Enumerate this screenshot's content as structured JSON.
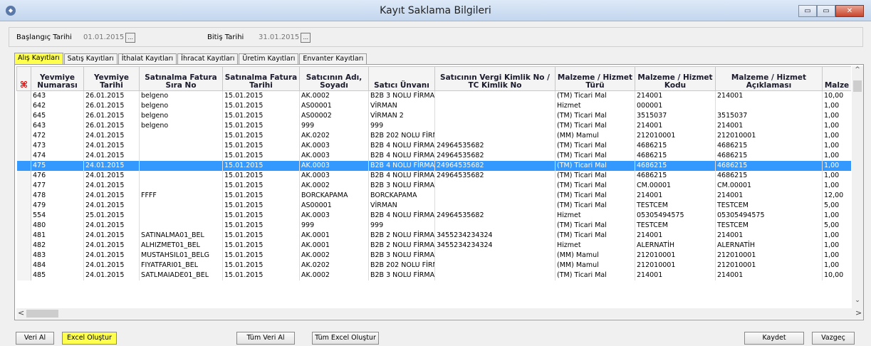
{
  "window": {
    "title": "Kayıt Saklama Bilgileri",
    "min": "▭",
    "max": "▭",
    "close": "✕"
  },
  "dates": {
    "start_label": "Başlangıç Tarihi",
    "start_value": "01.01.2015",
    "end_label": "Bitiş Tarihi",
    "end_value": "31.01.2015",
    "picker": "..."
  },
  "tabs": [
    "Alış Kayıtları",
    "Satış Kayıtları",
    "İthalat Kayıtları",
    "İhracat Kayıtları",
    "Üretim Kayıtları",
    "Envanter Kayıtları"
  ],
  "grid": {
    "corner_icon": "⌘",
    "columns": [
      "Yevmiye Numarası",
      "Yevmiye Tarihi",
      "Satınalma Fatura Sıra No",
      "Satınalma Fatura Tarihi",
      "Satıcının Adı, Soyadı",
      "Satıcı Ünvanı",
      "Satıcının Vergi Kimlik No / TC Kimlik No",
      "Malzeme / Hizmet Türü",
      "Malzeme / Hizmet Kodu",
      "Malzeme / Hizmet Açıklaması",
      "Malze"
    ],
    "rows": [
      [
        "643",
        "26.01.2015",
        "belgeno",
        "15.01.2015",
        "AK.0002",
        "B2B 3 NOLU FİRMA",
        "",
        "(TM) Ticari Mal",
        "214001",
        "214001",
        "10,00"
      ],
      [
        "642",
        "26.01.2015",
        "belgeno",
        "15.01.2015",
        "AS00001",
        "VİRMAN",
        "",
        "Hizmet",
        "000001",
        "",
        "1,00"
      ],
      [
        "645",
        "26.01.2015",
        "belgeno",
        "15.01.2015",
        "AS00002",
        "VİRMAN 2",
        "",
        "(TM) Ticari Mal",
        "3515037",
        "3515037",
        "1,00"
      ],
      [
        "643",
        "26.01.2015",
        "belgeno",
        "15.01.2015",
        "999",
        "999",
        "",
        "(TM) Ticari Mal",
        "214001",
        "214001",
        "1,00"
      ],
      [
        "472",
        "24.01.2015",
        "",
        "15.01.2015",
        "AK.0202",
        "B2B 202 NOLU FİRM.",
        "",
        "(MM) Mamul",
        "212010001",
        "212010001",
        "1,00"
      ],
      [
        "473",
        "24.01.2015",
        "",
        "15.01.2015",
        "AK.0003",
        "B2B 4 NOLU FİRMA",
        "24964535682",
        "(TM) Ticari Mal",
        "4686215",
        "4686215",
        "1,00"
      ],
      [
        "474",
        "24.01.2015",
        "",
        "15.01.2015",
        "AK.0003",
        "B2B 4 NOLU FİRMA",
        "24964535682",
        "(TM) Ticari Mal",
        "4686215",
        "4686215",
        "1,00"
      ],
      [
        "475",
        "24.01.2015",
        "",
        "15.01.2015",
        "AK.0003",
        "B2B 4 NOLU FİRMA",
        "24964535682",
        "(TM) Ticari Mal",
        "4686215",
        "4686215",
        "1,00"
      ],
      [
        "476",
        "24.01.2015",
        "",
        "15.01.2015",
        "AK.0003",
        "B2B 4 NOLU FİRMA",
        "24964535682",
        "(TM) Ticari Mal",
        "4686215",
        "4686215",
        "1,00"
      ],
      [
        "477",
        "24.01.2015",
        "",
        "15.01.2015",
        "AK.0002",
        "B2B 3 NOLU FİRMA",
        "",
        "(TM) Ticari Mal",
        "CM.00001",
        "CM.00001",
        "1,00"
      ],
      [
        "478",
        "24.01.2015",
        "FFFF",
        "15.01.2015",
        "BORCKAPAMA",
        "BORCKAPAMA",
        "",
        "(TM) Ticari Mal",
        "214001",
        "214001",
        "12,00"
      ],
      [
        "479",
        "24.01.2015",
        "",
        "15.01.2015",
        "AS00001",
        "VİRMAN",
        "",
        "(TM) Ticari Mal",
        "TESTCEM",
        "TESTCEM",
        "5,00"
      ],
      [
        "554",
        "25.01.2015",
        "",
        "15.01.2015",
        "AK.0003",
        "B2B 4 NOLU FİRMA",
        "24964535682",
        "Hizmet",
        "05305494575",
        "05305494575",
        "1,00"
      ],
      [
        "480",
        "24.01.2015",
        "",
        "15.01.2015",
        "999",
        "999",
        "",
        "(TM) Ticari Mal",
        "TESTCEM",
        "TESTCEM",
        "5,00"
      ],
      [
        "481",
        "24.01.2015",
        "SATINALMA01_BEL",
        "15.01.2015",
        "AK.0001",
        "B2B 2 NOLU FİRMA",
        "3455234234324",
        "(TM) Ticari Mal",
        "214001",
        "214001",
        "1,00"
      ],
      [
        "482",
        "24.01.2015",
        "ALHIZMET01_BEL",
        "15.01.2015",
        "AK.0001",
        "B2B 2 NOLU FİRMA",
        "3455234234324",
        "Hizmet",
        "ALERNATİH",
        "ALERNATİH",
        "1,00"
      ],
      [
        "483",
        "24.01.2015",
        "MUSTAHSIL01_BELG",
        "15.01.2015",
        "AK.0002",
        "B2B 3 NOLU FİRMA",
        "",
        "(MM) Mamul",
        "212010001",
        "212010001",
        "1,00"
      ],
      [
        "484",
        "24.01.2015",
        "FIYATFARI01_BEL",
        "15.01.2015",
        "AK.0202",
        "B2B 202 NOLU FİRM.",
        "",
        "(MM) Mamul",
        "212010001",
        "212010001",
        "1,00"
      ],
      [
        "485",
        "24.01.2015",
        "SATLMAIADE01_BEL",
        "15.01.2015",
        "AK.0002",
        "B2B 3 NOLU FİRMA",
        "",
        "(TM) Ticari Mal",
        "214001",
        "214001",
        "10,00"
      ]
    ],
    "selected_row": 7
  },
  "scroll": {
    "up": "^",
    "down": "⌄",
    "left": "<",
    "right": ">"
  },
  "buttons": {
    "veri_al": "Veri Al",
    "excel": "Excel Oluştur",
    "tum_veri": "Tüm Veri Al",
    "tum_excel": "Tüm Excel Oluştur",
    "kaydet": "Kaydet",
    "vazgec": "Vazgeç"
  }
}
